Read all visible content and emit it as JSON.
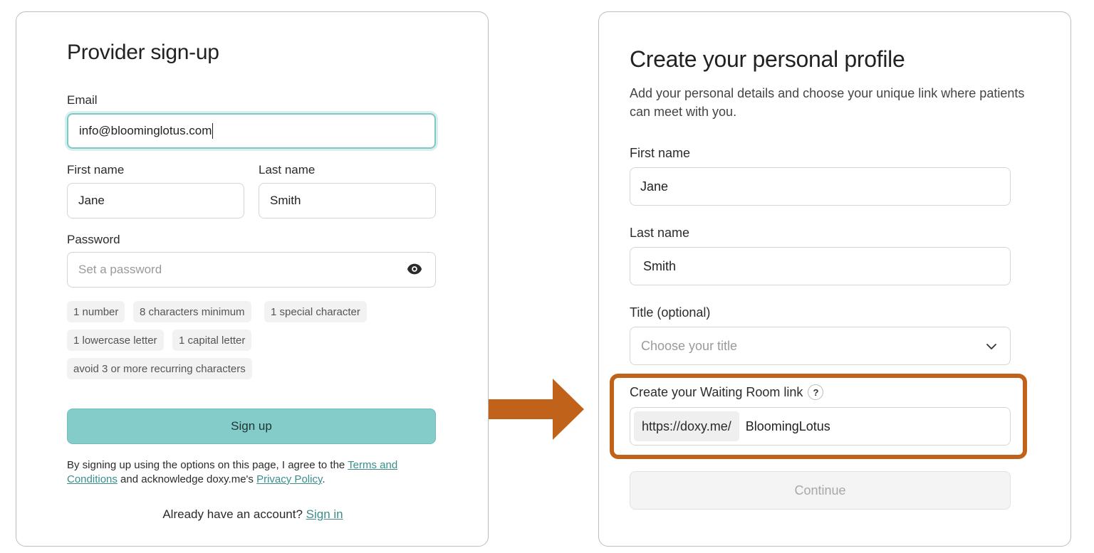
{
  "signup": {
    "title": "Provider sign-up",
    "email_label": "Email",
    "email_value": "info@bloominglotus.com",
    "first_name_label": "First name",
    "first_name_value": "Jane",
    "last_name_label": "Last name",
    "last_name_value": "Smith",
    "password_label": "Password",
    "password_placeholder": "Set a password",
    "requirements": [
      "1 number",
      "8 characters minimum",
      "1 special character",
      "1 lowercase letter",
      "1 capital letter",
      "avoid 3 or more recurring characters"
    ],
    "button_label": "Sign up",
    "legal_prefix": "By signing up using the options on this page, I agree to the ",
    "terms_link": "Terms and Conditions",
    "legal_middle": " and acknowledge doxy.me's ",
    "privacy_link": "Privacy Policy",
    "legal_suffix": ".",
    "signin_prompt": "Already have an account? ",
    "signin_link": "Sign in"
  },
  "profile": {
    "title": "Create your personal profile",
    "subtitle": "Add your personal details and choose your unique link where patients can meet with you.",
    "first_name_label": "First name",
    "first_name_value": "Jane",
    "last_name_label": "Last name",
    "last_name_value": "Smith",
    "title_label": "Title (optional)",
    "title_placeholder": "Choose your title",
    "waiting_room_label": "Create your Waiting Room link",
    "help_glyph": "?",
    "url_prefix": "https://doxy.me/",
    "url_value": "BloomingLotus",
    "continue_label": "Continue"
  },
  "colors": {
    "accent_teal": "#84ccc9",
    "link_teal": "#3a8e8a",
    "highlight_orange": "#c0621a"
  },
  "icons": {
    "password_toggle": "eye-icon",
    "title_dropdown": "chevron-down-icon",
    "flow_arrow": "arrow-right-icon"
  }
}
